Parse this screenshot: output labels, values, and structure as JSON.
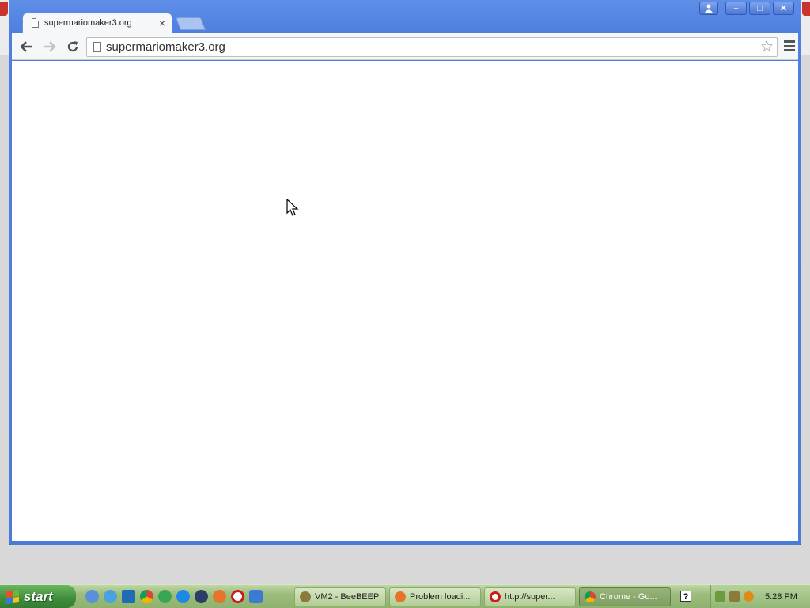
{
  "browser": {
    "tab_title": "supermariomaker3.org",
    "tab_close": "×",
    "url": "supermariomaker3.org",
    "window_controls": {
      "minimize": "–",
      "maximize": "□",
      "close": "✕"
    }
  },
  "taskbar": {
    "start_label": "start",
    "quick_launch": [
      "ie-globe-icon",
      "swirl-icon",
      "puzzle-icon",
      "chrome-icon",
      "recycle-icon",
      "ie-icon",
      "media-icon",
      "firefox-icon",
      "opera-icon",
      "wizard-icon"
    ],
    "tasks": [
      {
        "label": "VM2 - BeeBEEP",
        "icon": "beebeep-icon",
        "color": "#8b7a3a",
        "active": false
      },
      {
        "label": "Problem loadi...",
        "icon": "firefox-icon",
        "color": "#e8732a",
        "active": false
      },
      {
        "label": "http://super...",
        "icon": "opera-icon",
        "color": "#cc1b1b",
        "active": false
      },
      {
        "label": "Chrome - Go...",
        "icon": "chrome-icon",
        "color": "#3b8be0",
        "active": true
      }
    ],
    "help": "?",
    "clock": "5:28 PM"
  }
}
